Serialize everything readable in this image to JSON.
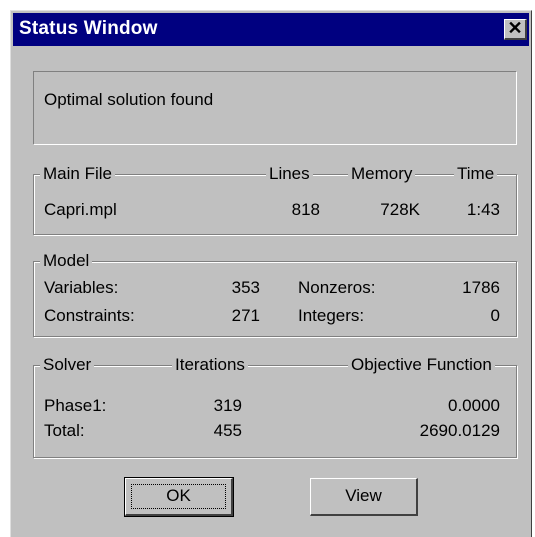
{
  "window": {
    "title": "Status Window",
    "close_glyph": "✕"
  },
  "status": {
    "message": "Optimal solution found"
  },
  "main_file": {
    "headers": {
      "file": "Main File",
      "lines": "Lines",
      "memory": "Memory",
      "time": "Time"
    },
    "file": "Capri.mpl",
    "lines": "818",
    "memory": "728K",
    "time": "1:43"
  },
  "model": {
    "legend": "Model",
    "variables_label": "Variables:",
    "variables": "353",
    "constraints_label": "Constraints:",
    "constraints": "271",
    "nonzeros_label": "Nonzeros:",
    "nonzeros": "1786",
    "integers_label": "Integers:",
    "integers": "0"
  },
  "solver": {
    "headers": {
      "solver": "Solver",
      "iterations": "Iterations",
      "objective": "Objective Function"
    },
    "phase1_label": "Phase1:",
    "phase1_iterations": "319",
    "phase1_objective": "0.0000",
    "total_label": "Total:",
    "total_iterations": "455",
    "total_objective": "2690.0129"
  },
  "buttons": {
    "ok": "OK",
    "view": "View"
  }
}
